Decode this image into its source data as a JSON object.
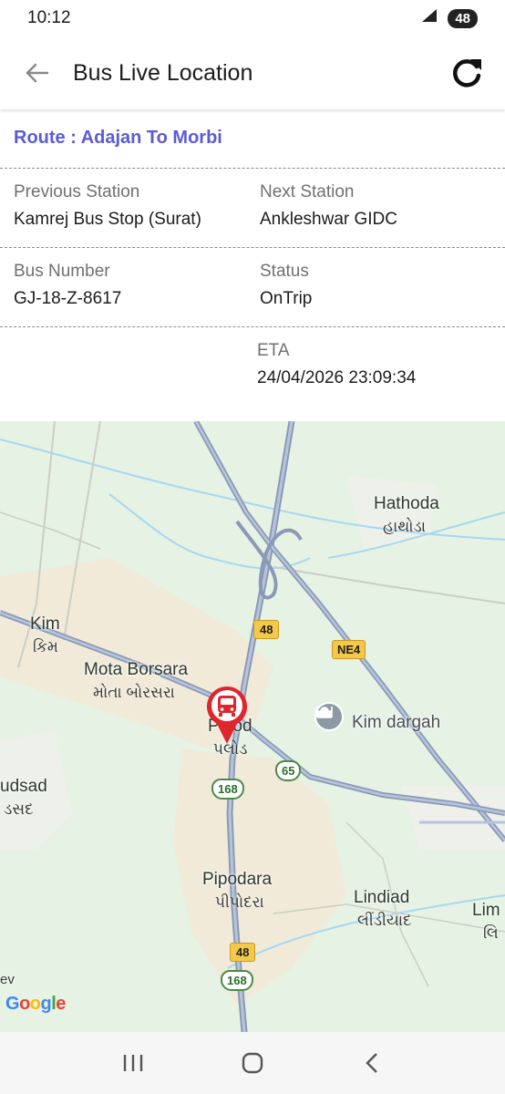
{
  "status_bar": {
    "time": "10:12",
    "battery": "48"
  },
  "header": {
    "title": "Bus Live Location"
  },
  "route": {
    "text": "Route : Adajan To Morbi"
  },
  "trip": {
    "previous_station_label": "Previous Station",
    "previous_station_value": "Kamrej Bus Stop (Surat)",
    "next_station_label": "Next Station",
    "next_station_value": "Ankleshwar GIDC",
    "bus_number_label": "Bus Number",
    "bus_number_value": "GJ-18-Z-8617",
    "status_label": "Status",
    "status_value": "OnTrip",
    "eta_label": "ETA",
    "eta_value": "24/04/2026 23:09:34"
  },
  "map": {
    "labels": {
      "hathoda": "Hathoda",
      "hathoda_gu": "હાથોડા",
      "kim": "Kim",
      "kim_gu": "કિમ",
      "mota_borsara": "Mota Borsara",
      "mota_borsara_gu": "મોતા બોરસરા",
      "palod": "Palod",
      "palod_gu": "પલોડ",
      "kim_dargah": "Kim dargah",
      "pipodara": "Pipodara",
      "pipodara_gu": "પીપોદરા",
      "lindiad": "Lindiad",
      "lindiad_gu": "લીંડીયાદ",
      "udsad": "udsad",
      "udsad_gu": "ડસદ",
      "lim": "Lim",
      "lim_gu": "લિ",
      "ev": "ev"
    },
    "shields": {
      "nh48_top": "48",
      "ne4": "NE4",
      "sh65": "65",
      "sh168_top": "168",
      "nh48_bottom": "48",
      "sh168_bottom": "168"
    },
    "google": "Google"
  },
  "colors": {
    "accent": "#5b5bd6",
    "bus_marker": "#e0262d",
    "road": "#97a5bd",
    "water": "#9fd3f0"
  }
}
